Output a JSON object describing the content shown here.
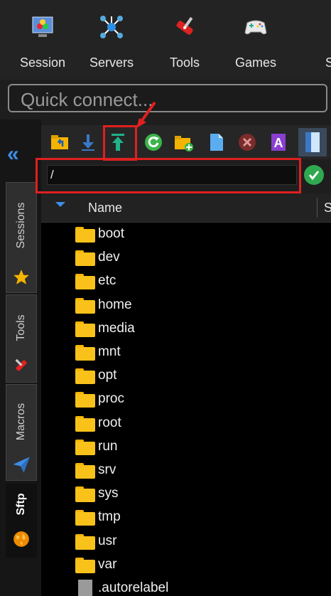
{
  "toolbar": {
    "items": [
      {
        "label": "Session",
        "icon": "session-icon"
      },
      {
        "label": "Servers",
        "icon": "servers-icon"
      },
      {
        "label": "Tools",
        "icon": "tools-icon"
      },
      {
        "label": "Games",
        "icon": "games-icon"
      },
      {
        "label": "S",
        "icon": "settings-icon"
      }
    ]
  },
  "quick_connect": {
    "placeholder": "Quick connect..."
  },
  "side_tabs": [
    {
      "label": "Sessions",
      "icon": "star-icon"
    },
    {
      "label": "Tools",
      "icon": "tools-icon"
    },
    {
      "label": "Macros",
      "icon": "paper-plane-icon"
    },
    {
      "label": "Sftp",
      "icon": "globe-icon"
    }
  ],
  "sftp": {
    "path": "/",
    "column_name": "Name",
    "column_next": "S",
    "files": [
      {
        "name": "boot",
        "type": "folder"
      },
      {
        "name": "dev",
        "type": "folder"
      },
      {
        "name": "etc",
        "type": "folder"
      },
      {
        "name": "home",
        "type": "folder"
      },
      {
        "name": "media",
        "type": "folder"
      },
      {
        "name": "mnt",
        "type": "folder"
      },
      {
        "name": "opt",
        "type": "folder"
      },
      {
        "name": "proc",
        "type": "folder"
      },
      {
        "name": "root",
        "type": "folder"
      },
      {
        "name": "run",
        "type": "folder"
      },
      {
        "name": "srv",
        "type": "folder"
      },
      {
        "name": "sys",
        "type": "folder"
      },
      {
        "name": "tmp",
        "type": "folder"
      },
      {
        "name": "usr",
        "type": "folder"
      },
      {
        "name": "var",
        "type": "folder"
      },
      {
        "name": ".autorelabel",
        "type": "file"
      }
    ]
  },
  "colors": {
    "accent": "#3d8ee6",
    "annotation": "#e02020",
    "folder": "#f9c21a"
  }
}
